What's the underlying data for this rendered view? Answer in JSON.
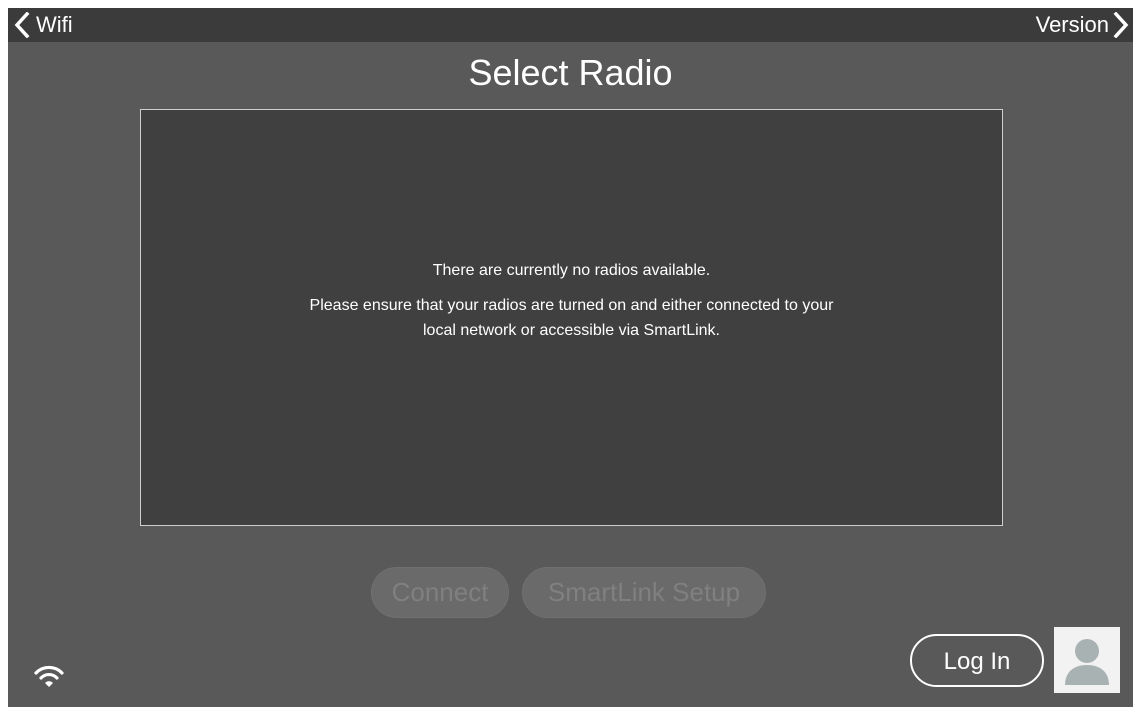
{
  "topbar": {
    "back_label": "Wifi",
    "forward_label": "Version"
  },
  "page": {
    "title": "Select Radio"
  },
  "radio_list": {
    "empty_title": "There are currently no radios available.",
    "empty_hint": "Please ensure that your radios are turned on and either connected to your local network or accessible via SmartLink."
  },
  "actions": {
    "connect_label": "Connect",
    "smartlink_setup_label": "SmartLink Setup"
  },
  "footer": {
    "login_label": "Log In",
    "wifi_icon": "wifi-icon",
    "avatar_icon": "user-avatar-icon"
  },
  "colors": {
    "background": "#595959",
    "topbar": "#3b3b3b",
    "panel": "#404040",
    "disabled_button": "#6a6a6a",
    "text": "#ffffff"
  }
}
